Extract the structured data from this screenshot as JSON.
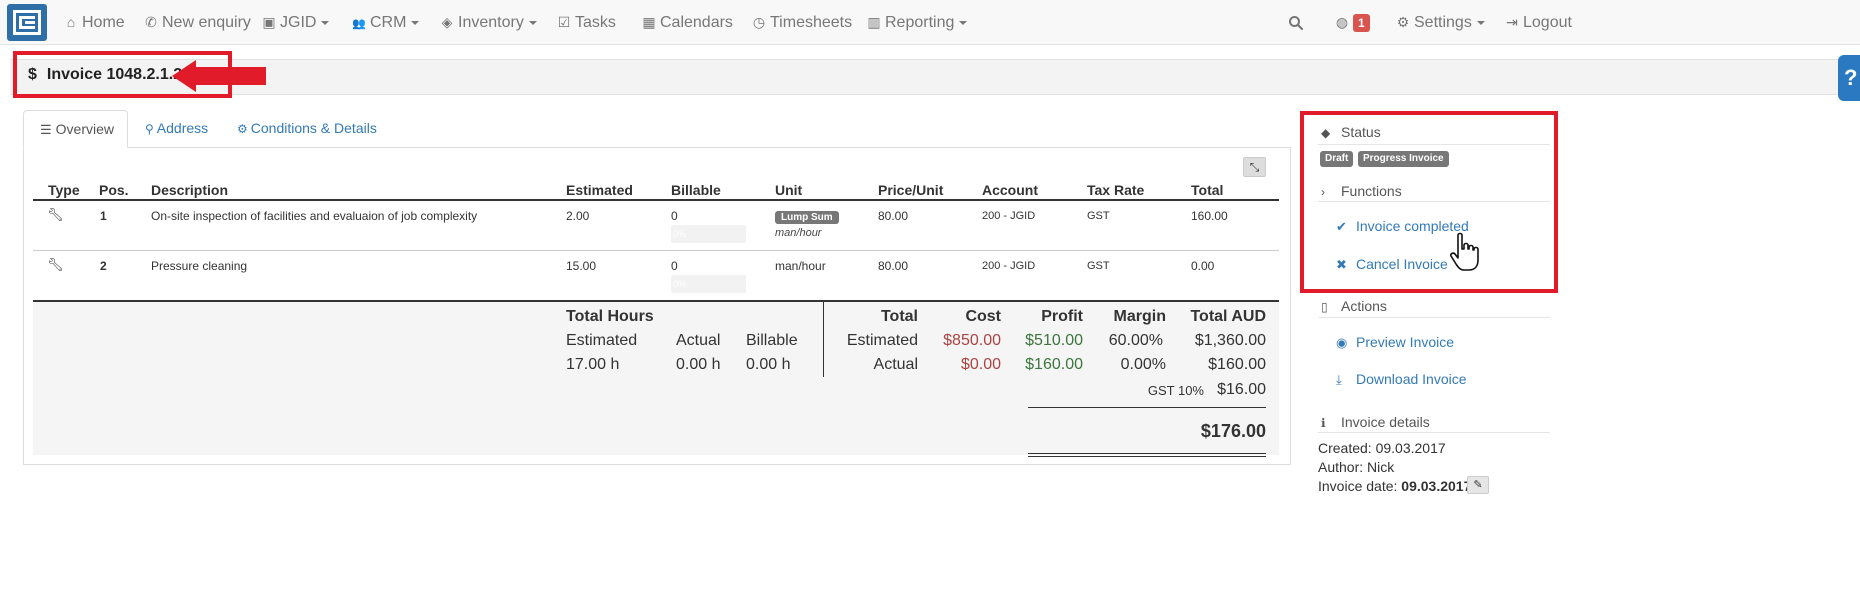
{
  "nav": {
    "items": [
      {
        "label": "Home",
        "icon": "home-icon",
        "glyph": "⌂"
      },
      {
        "label": "New enquiry",
        "icon": "phone-icon",
        "glyph": "✆"
      },
      {
        "label": "JGID",
        "icon": "jgid-logo-icon",
        "glyph": "▣"
      },
      {
        "label": "CRM",
        "icon": "users-icon",
        "glyph": "👥"
      },
      {
        "label": "Inventory",
        "icon": "cubes-icon",
        "glyph": "◈"
      },
      {
        "label": "Tasks",
        "icon": "check-square-icon",
        "glyph": "☑"
      },
      {
        "label": "Calendars",
        "icon": "calendar-icon",
        "glyph": "▦"
      },
      {
        "label": "Timesheets",
        "icon": "clock-icon",
        "glyph": "◷"
      },
      {
        "label": "Reporting",
        "icon": "bar-chart-icon",
        "glyph": "▥"
      }
    ],
    "notification_count": "1",
    "settings_label": "Settings",
    "logout_label": "Logout"
  },
  "page": {
    "title": "Invoice 1048.2.1.2",
    "help_glyph": "?"
  },
  "tabs": {
    "overview": "Overview",
    "address": "Address",
    "conditions": "Conditions & Details"
  },
  "table": {
    "headers": {
      "type": "Type",
      "pos": "Pos.",
      "description": "Description",
      "estimated": "Estimated",
      "billable": "Billable",
      "unit": "Unit",
      "price_unit": "Price/Unit",
      "account": "Account",
      "tax_rate": "Tax Rate",
      "total": "Total"
    },
    "rows": [
      {
        "pos": "1",
        "description": "On-site inspection of facilities and evaluaion of job complexity",
        "estimated": "2.00",
        "billable": "0",
        "progress": "0%",
        "unit_badge": "Lump Sum",
        "unit": "man/hour",
        "price": "80.00",
        "account": "200 - JGID",
        "tax": "GST",
        "total": "160.00"
      },
      {
        "pos": "2",
        "description": "Pressure cleaning",
        "estimated": "15.00",
        "billable": "0",
        "progress": "0%",
        "unit_badge": "",
        "unit": "man/hour",
        "price": "80.00",
        "account": "200 - JGID",
        "tax": "GST",
        "total": "0.00"
      }
    ]
  },
  "hours": {
    "title": "Total Hours",
    "estimated_label": "Estimated",
    "actual_label": "Actual",
    "billable_label": "Billable",
    "estimated_value": "17.00 h",
    "actual_value": "0.00 h",
    "billable_value": "0.00 h"
  },
  "totals": {
    "headers": {
      "total": "Total",
      "cost": "Cost",
      "profit": "Profit",
      "margin": "Margin",
      "total_aud": "Total AUD"
    },
    "estimated": {
      "label": "Estimated",
      "cost": "$850.00",
      "profit": "$510.00",
      "margin": "60.00%",
      "total": "$1,360.00"
    },
    "actual": {
      "label": "Actual",
      "cost": "$0.00",
      "profit": "$160.00",
      "margin": "0.00%",
      "total": "$160.00"
    },
    "gst_label": "GST 10%",
    "gst_value": "$16.00",
    "grand_total": "$176.00"
  },
  "sidebar": {
    "status_label": "Status",
    "badges": [
      "Draft",
      "Progress Invoice"
    ],
    "functions_label": "Functions",
    "invoice_completed": "Invoice completed",
    "cancel_invoice": "Cancel Invoice",
    "actions_label": "Actions",
    "preview_invoice": "Preview Invoice",
    "download_invoice": "Download Invoice",
    "details_label": "Invoice details",
    "created": "Created: 09.03.2017",
    "author": "Author: Nick",
    "invoice_date_label": "Invoice date:",
    "invoice_date": "09.03.2017"
  },
  "colors": {
    "annotation_red": "#e21b2a",
    "link_blue": "#337ab7",
    "cost_red": "#a94442",
    "profit_green": "#3c763d"
  }
}
